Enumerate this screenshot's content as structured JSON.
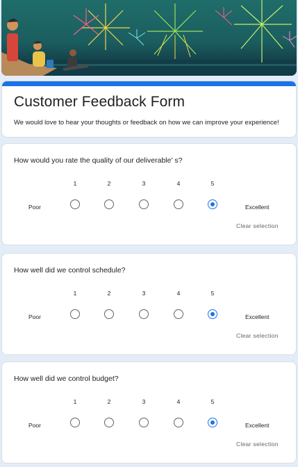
{
  "banner": {
    "colors": {
      "sky": "#1f6d6a",
      "sea": "#0f3440",
      "firework_yellow": "#f5d547",
      "firework_green": "#9be25a",
      "firework_pink": "#ff5a8a"
    }
  },
  "form": {
    "title": "Customer Feedback Form",
    "description": "We would love to hear your thoughts or feedback on how we can improve your experience!",
    "accent_color": "#1a73e8"
  },
  "questions": [
    {
      "text": "How would you rate the quality of our deliverable' s?",
      "scale": [
        "1",
        "2",
        "3",
        "4",
        "5"
      ],
      "low_label": "Poor",
      "high_label": "Excellent",
      "selected": "5",
      "clear_label": "Clear selection"
    },
    {
      "text": "How well did we control schedule?",
      "scale": [
        "1",
        "2",
        "3",
        "4",
        "5"
      ],
      "low_label": "Poor",
      "high_label": "Excellent",
      "selected": "5",
      "clear_label": "Clear selection"
    },
    {
      "text": "How well did we control budget?",
      "scale": [
        "1",
        "2",
        "3",
        "4",
        "5"
      ],
      "low_label": "Poor",
      "high_label": "Excellent",
      "selected": "5",
      "clear_label": "Clear selection"
    }
  ]
}
